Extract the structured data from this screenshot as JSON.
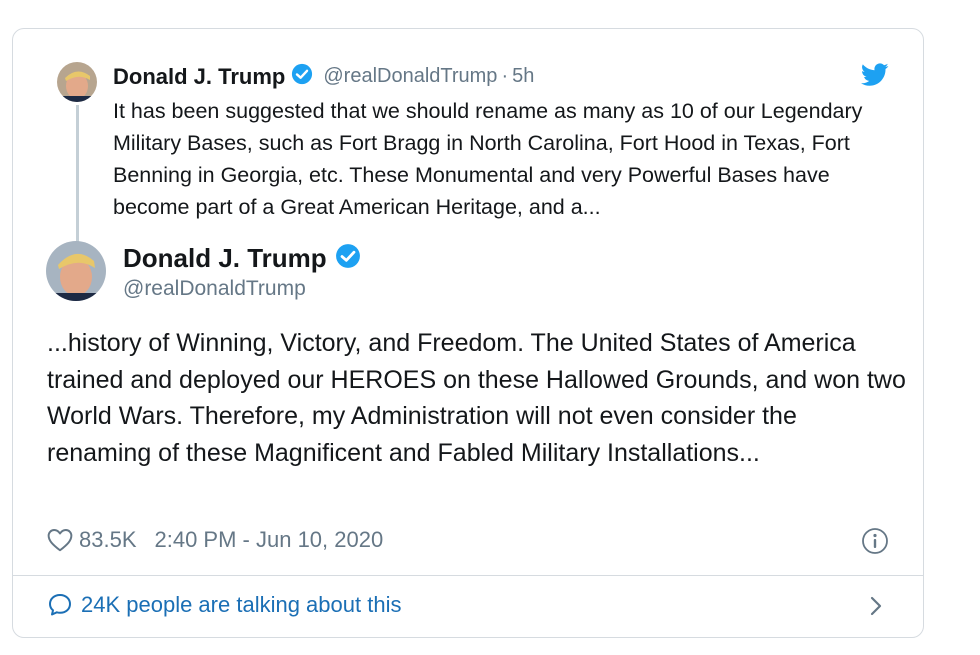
{
  "parent_tweet": {
    "name": "Donald J. Trump",
    "handle": "@realDonaldTrump",
    "separator": "·",
    "time": "5h",
    "text": "It has been suggested that we should rename as many as 10 of our Legendary Military Bases, such as Fort Bragg in North Carolina, Fort Hood in Texas, Fort Benning in Georgia, etc. These Monumental and very Powerful Bases have become part of a Great American Heritage, and a..."
  },
  "main_tweet": {
    "name": "Donald J. Trump",
    "handle": "@realDonaldTrump",
    "text": "...history of Winning, Victory, and Freedom. The United States of America trained and deployed our HEROES on these Hallowed Grounds, and won two World Wars. Therefore, my Administration will not even consider the renaming of these Magnificent and Fabled Military Installations...",
    "likes": "83.5K",
    "timestamp": "2:40 PM - Jun 10, 2020"
  },
  "conversation": {
    "label": "24K people are talking about this"
  },
  "icons": {
    "verified": "verified-badge-icon",
    "brand": "twitter-bird-icon",
    "like": "heart-icon",
    "info": "info-icon",
    "reply": "comment-icon",
    "chevron": "chevron-right-icon"
  },
  "colors": {
    "brand_blue": "#1da1f2",
    "link_blue": "#1b6fb5",
    "text_primary": "#14171a",
    "text_secondary": "#657786",
    "border": "#d6dbe0"
  }
}
